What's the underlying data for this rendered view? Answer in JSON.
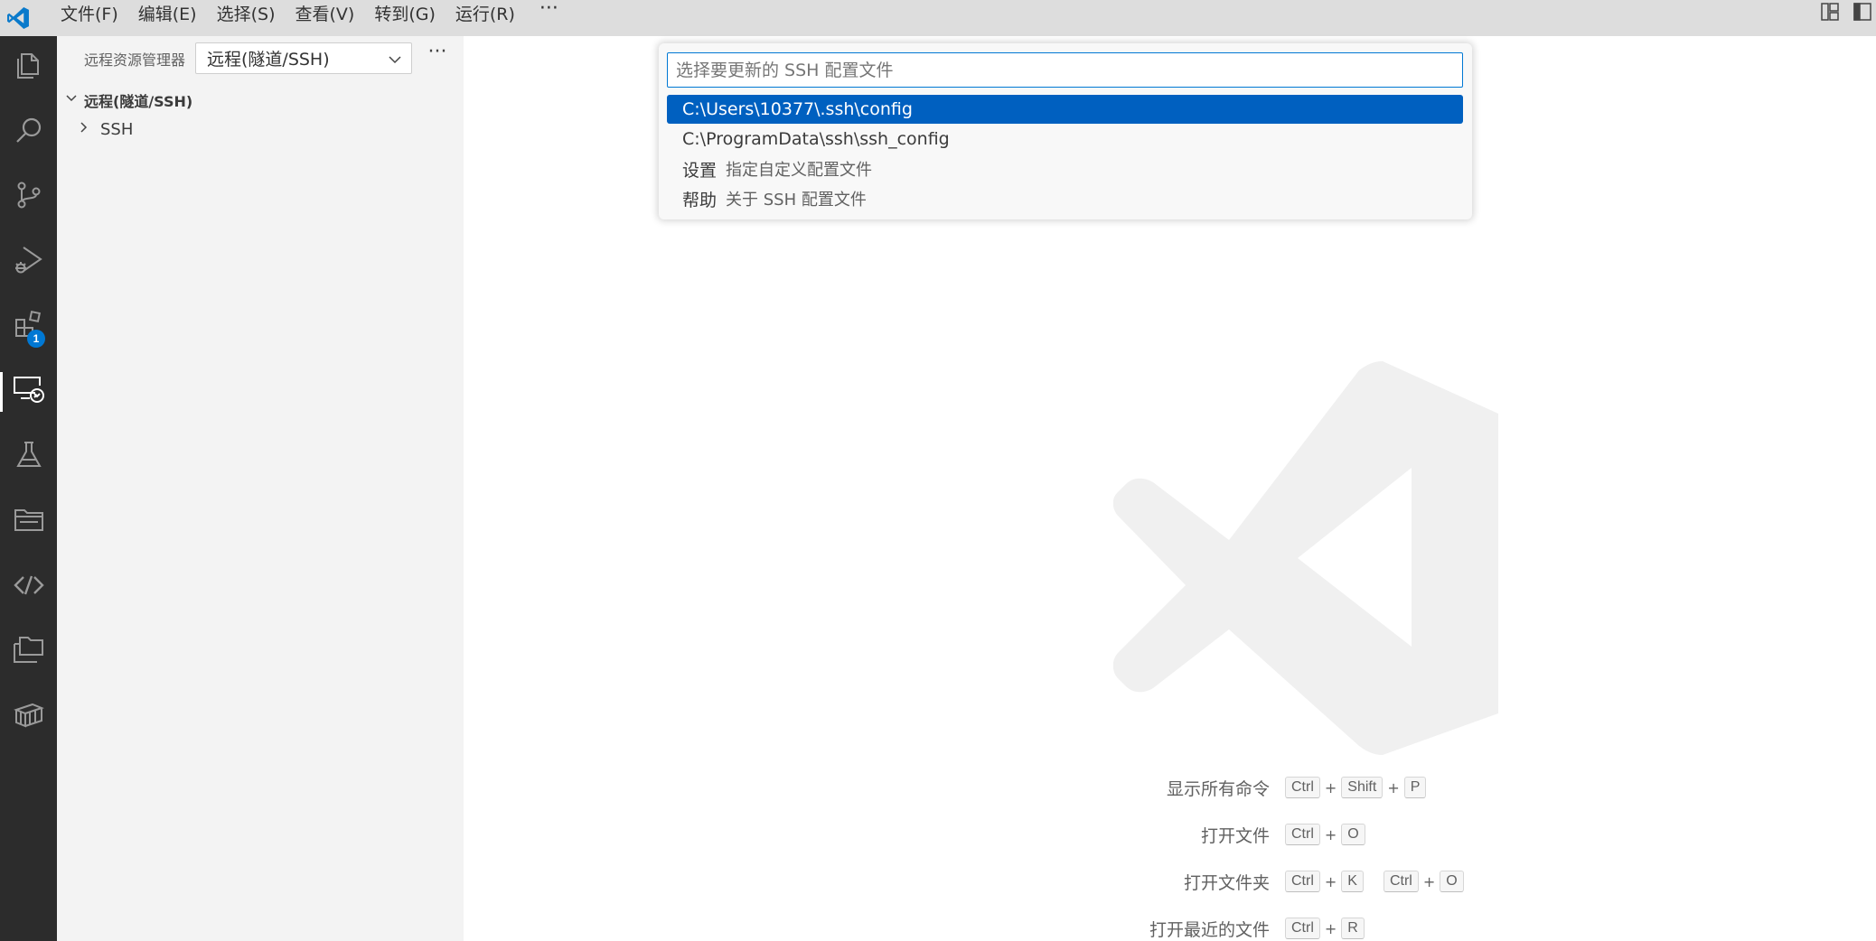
{
  "menu": {
    "items": [
      "文件(F)",
      "编辑(E)",
      "选择(S)",
      "查看(V)",
      "转到(G)",
      "运行(R)"
    ],
    "more": "···"
  },
  "activity": {
    "items": [
      {
        "name": "explorer-icon"
      },
      {
        "name": "search-icon"
      },
      {
        "name": "source-control-icon"
      },
      {
        "name": "run-debug-icon"
      },
      {
        "name": "extensions-icon",
        "badge": "1"
      },
      {
        "name": "remote-explorer-icon",
        "active": true
      },
      {
        "name": "testing-icon"
      },
      {
        "name": "folder-icon"
      },
      {
        "name": "remote-code-icon"
      },
      {
        "name": "folders-icon"
      },
      {
        "name": "package-icon"
      }
    ],
    "extensions_badge": "1"
  },
  "sidebar": {
    "title": "远程资源管理器",
    "select_value": "远程(隧道/SSH)",
    "more": "···",
    "section_label": "远程(隧道/SSH)",
    "tree_item": "SSH"
  },
  "quickpick": {
    "placeholder": "选择要更新的 SSH 配置文件",
    "items": [
      {
        "label": "C:\\Users\\10377\\.ssh\\config",
        "description": "",
        "selected": true
      },
      {
        "label": "C:\\ProgramData\\ssh\\ssh_config",
        "description": ""
      },
      {
        "label": "设置",
        "description": "指定自定义配置文件"
      },
      {
        "label": "帮助",
        "description": "关于 SSH 配置文件"
      }
    ]
  },
  "shortcuts": [
    {
      "label": "显示所有命令",
      "keys": [
        "Ctrl",
        "+",
        "Shift",
        "+",
        "P"
      ]
    },
    {
      "label": "打开文件",
      "keys": [
        "Ctrl",
        "+",
        "O"
      ]
    },
    {
      "label": "打开文件夹",
      "keys": [
        "Ctrl",
        "+",
        "K",
        " ",
        "Ctrl",
        "+",
        "O"
      ]
    },
    {
      "label": "打开最近的文件",
      "keys": [
        "Ctrl",
        "+",
        "R"
      ]
    }
  ],
  "colors": {
    "accent": "#0078d4",
    "selection": "#0060c0",
    "activity_bar": "#2c2c2c",
    "sidebar": "#f3f3f3",
    "titlebar": "#dddddd"
  }
}
